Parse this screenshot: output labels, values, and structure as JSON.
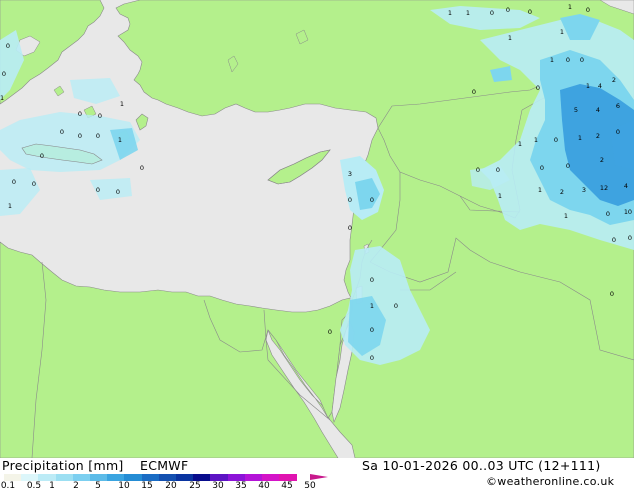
{
  "map": {
    "colors": {
      "sea": "#e8e8e8",
      "land": "#b4f08c",
      "border": "#8a8a8a",
      "precip_light": "#b8ecf5",
      "precip_mid": "#7dd6ee",
      "precip_heavy": "#3ea3e0"
    },
    "grid_values": [
      "1",
      "1",
      "0",
      "0",
      "0",
      "1",
      "0",
      "1",
      "1",
      "1",
      "0",
      "0",
      "1",
      "4",
      "2",
      "5",
      "4",
      "6",
      "1",
      "0",
      "1",
      "2",
      "0",
      "2",
      "1",
      "2",
      "3",
      "12",
      "4",
      "1",
      "0",
      "1",
      "0",
      "0",
      "1",
      "0",
      "0",
      "0",
      "0",
      "0",
      "0",
      "1",
      "0",
      "0",
      "0",
      "1",
      "0",
      "0",
      "0",
      "0",
      "1",
      "0",
      "0",
      "3",
      "0",
      "0",
      "0",
      "0",
      "1",
      "0",
      "0",
      "0",
      "0",
      "1",
      "0",
      "0",
      "1",
      "0",
      "0",
      "0",
      "0"
    ]
  },
  "footer": {
    "title": "Precipitation [mm]",
    "model": "ECMWF",
    "datetime": "Sa 10-01-2026 00..03 UTC (12+111)",
    "credit": "©weatheronline.co.uk"
  },
  "legend": {
    "colors": [
      "#f4f4e8",
      "#dcf6fa",
      "#bcebf6",
      "#9cdff2",
      "#7ccff0",
      "#5cbbe8",
      "#3aa4e0",
      "#248cd4",
      "#1a6cc4",
      "#1450b0",
      "#0a34a0",
      "#080c8c",
      "#5c14c4",
      "#8c14d8",
      "#b414d8",
      "#d414c8",
      "#e014b0",
      "#c8198c"
    ],
    "ticks": [
      "0.1",
      "0.5",
      "1",
      "2",
      "5",
      "10",
      "15",
      "20",
      "25",
      "30",
      "35",
      "40",
      "45",
      "50"
    ]
  }
}
